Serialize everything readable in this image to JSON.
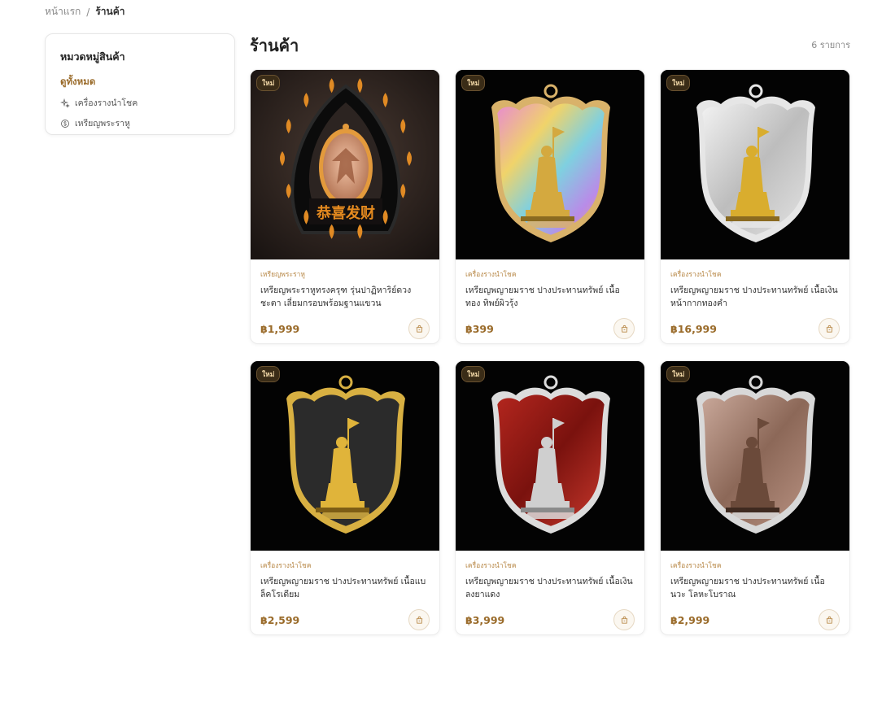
{
  "breadcrumb": {
    "home": "หน้าแรก",
    "separator": "/",
    "current": "ร้านค้า"
  },
  "sidebar": {
    "title": "หมวดหมู่สินค้า",
    "items": [
      {
        "label": "ดูทั้งหมด",
        "icon": "none",
        "active": true
      },
      {
        "label": "เครื่องรางนำโชค",
        "icon": "sparkles-icon",
        "active": false
      },
      {
        "label": "เหรียญพระราหู",
        "icon": "coin-icon",
        "active": false
      }
    ]
  },
  "main": {
    "title": "ร้านค้า",
    "count": "6 รายการ"
  },
  "products": [
    {
      "badge": "ใหม่",
      "category": "เหรียญพระราหู",
      "name": "เหรียญพระราหูทรงครุฑ รุ่นปาฏิหาริย์ดวงชะตา เลี่ยมกรอบพร้อมฐานแขวน",
      "price": "฿1,999",
      "style": "rahu"
    },
    {
      "badge": "ใหม่",
      "category": "เครื่องรางนำโชค",
      "name": "เหรียญพญายมราช ปางประทานทรัพย์ เนื้อทอง ทิพย์ผิวรุ้ง",
      "price": "฿399",
      "style": "rainbow"
    },
    {
      "badge": "ใหม่",
      "category": "เครื่องรางนำโชค",
      "name": "เหรียญพญายมราช ปางประทานทรัพย์ เนื้อเงิน หน้ากากทองคำ",
      "price": "฿16,999",
      "style": "silver"
    },
    {
      "badge": "ใหม่",
      "category": "เครื่องรางนำโชค",
      "name": "เหรียญพญายมราช ปางประทานทรัพย์ เนื้อแบล็คโรเดียม",
      "price": "฿2,599",
      "style": "black"
    },
    {
      "badge": "ใหม่",
      "category": "เครื่องรางนำโชค",
      "name": "เหรียญพญายมราช ปางประทานทรัพย์ เนื้อเงิน ลงยาแดง",
      "price": "฿3,999",
      "style": "red"
    },
    {
      "badge": "ใหม่",
      "category": "เครื่องรางนำโชค",
      "name": "เหรียญพญายมราช ปางประทานทรัพย์ เนื้อนวะ โลหะโบราณ",
      "price": "฿2,999",
      "style": "bronze"
    }
  ],
  "colors": {
    "accent": "#9a6b2a",
    "badge_bg": "#3a2c17",
    "badge_text": "#f3d9a8"
  },
  "icons": {
    "cart": "shopping-bag-icon"
  }
}
